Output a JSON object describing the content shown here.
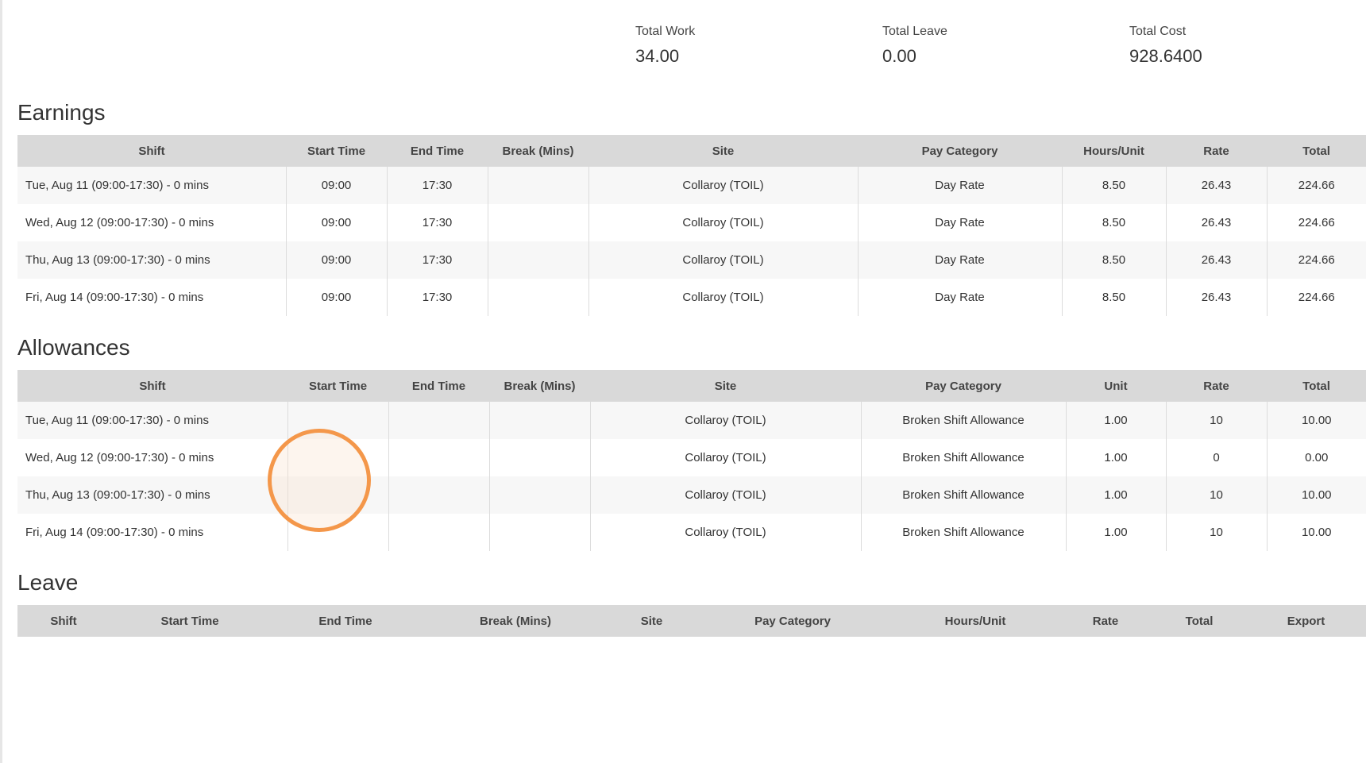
{
  "summary": {
    "total_work_label": "Total Work",
    "total_work_value": "34.00",
    "total_leave_label": "Total Leave",
    "total_leave_value": "0.00",
    "total_cost_label": "Total Cost",
    "total_cost_value": "928.6400"
  },
  "earnings": {
    "title": "Earnings",
    "headers": [
      "Shift",
      "Start Time",
      "End Time",
      "Break (Mins)",
      "Site",
      "Pay Category",
      "Hours/Unit",
      "Rate",
      "Total"
    ],
    "rows": [
      [
        "Tue, Aug 11 (09:00-17:30) - 0 mins",
        "09:00",
        "17:30",
        "",
        "Collaroy (TOIL)",
        "Day Rate",
        "8.50",
        "26.43",
        "224.66"
      ],
      [
        "Wed, Aug 12 (09:00-17:30) - 0 mins",
        "09:00",
        "17:30",
        "",
        "Collaroy (TOIL)",
        "Day Rate",
        "8.50",
        "26.43",
        "224.66"
      ],
      [
        "Thu, Aug 13 (09:00-17:30) - 0 mins",
        "09:00",
        "17:30",
        "",
        "Collaroy (TOIL)",
        "Day Rate",
        "8.50",
        "26.43",
        "224.66"
      ],
      [
        "Fri, Aug 14 (09:00-17:30) - 0 mins",
        "09:00",
        "17:30",
        "",
        "Collaroy (TOIL)",
        "Day Rate",
        "8.50",
        "26.43",
        "224.66"
      ]
    ]
  },
  "allowances": {
    "title": "Allowances",
    "headers": [
      "Shift",
      "Start Time",
      "End Time",
      "Break (Mins)",
      "Site",
      "Pay Category",
      "Unit",
      "Rate",
      "Total"
    ],
    "rows": [
      [
        "Tue, Aug 11 (09:00-17:30) - 0 mins",
        "",
        "",
        "",
        "Collaroy (TOIL)",
        "Broken Shift Allowance",
        "1.00",
        "10",
        "10.00"
      ],
      [
        "Wed, Aug 12 (09:00-17:30) - 0 mins",
        "",
        "",
        "",
        "Collaroy (TOIL)",
        "Broken Shift Allowance",
        "1.00",
        "0",
        "0.00"
      ],
      [
        "Thu, Aug 13 (09:00-17:30) - 0 mins",
        "",
        "",
        "",
        "Collaroy (TOIL)",
        "Broken Shift Allowance",
        "1.00",
        "10",
        "10.00"
      ],
      [
        "Fri, Aug 14 (09:00-17:30) - 0 mins",
        "",
        "",
        "",
        "Collaroy (TOIL)",
        "Broken Shift Allowance",
        "1.00",
        "10",
        "10.00"
      ]
    ]
  },
  "leave": {
    "title": "Leave",
    "headers": [
      "Shift",
      "Start Time",
      "End Time",
      "Break (Mins)",
      "Site",
      "Pay Category",
      "Hours/Unit",
      "Rate",
      "Total",
      "Export"
    ]
  },
  "colors": {
    "header_bg": "#d9d9d9",
    "row_alt_bg": "#f7f7f7",
    "cursor_ring": "#f4974a"
  }
}
